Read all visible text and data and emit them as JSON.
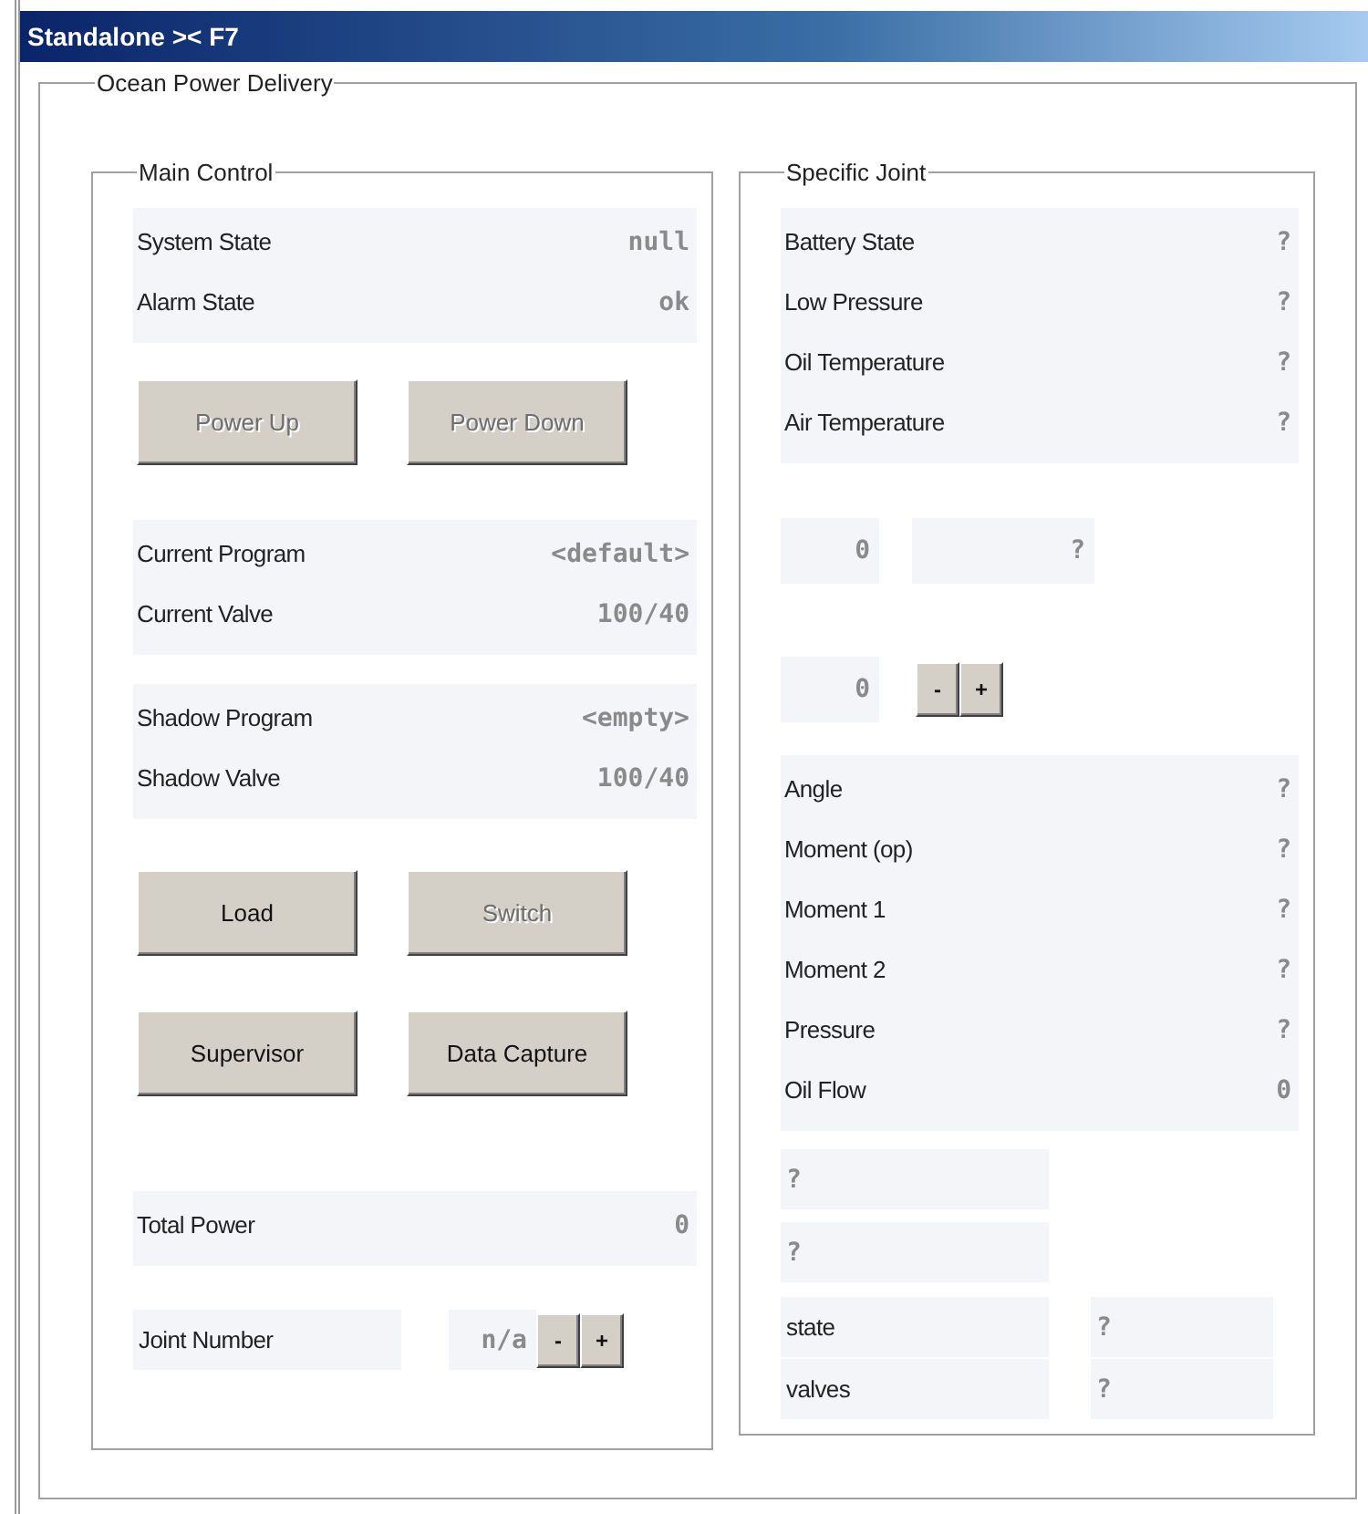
{
  "window": {
    "title": "Standalone >< F7"
  },
  "group": {
    "title": "Ocean Power Delivery"
  },
  "main_control": {
    "title": "Main Control",
    "status": [
      {
        "label": "System State",
        "value": "null"
      },
      {
        "label": "Alarm State",
        "value": "ok"
      }
    ],
    "power_buttons": [
      {
        "label": "Power Up",
        "disabled": true
      },
      {
        "label": "Power Down",
        "disabled": true
      }
    ],
    "current": [
      {
        "label": "Current Program",
        "value": "<default>"
      },
      {
        "label": "Current Valve",
        "value": "100/40"
      }
    ],
    "shadow": [
      {
        "label": "Shadow Program",
        "value": "<empty>"
      },
      {
        "label": "Shadow Valve",
        "value": "100/40"
      }
    ],
    "program_buttons": [
      {
        "label": "Load",
        "disabled": false
      },
      {
        "label": "Switch",
        "disabled": true
      }
    ],
    "tool_buttons": [
      {
        "label": "Supervisor",
        "disabled": false
      },
      {
        "label": "Data Capture",
        "disabled": false
      }
    ],
    "total_power": {
      "label": "Total Power",
      "value": "0"
    },
    "joint_number": {
      "label": "Joint Number",
      "value": "n/a",
      "steppers": [
        "-",
        "+"
      ]
    }
  },
  "specific_joint": {
    "title": "Specific Joint",
    "sensors": [
      {
        "label": "Battery State",
        "value": "?"
      },
      {
        "label": "Low Pressure",
        "value": "?"
      },
      {
        "label": "Oil Temperature",
        "value": "?"
      },
      {
        "label": "Air Temperature",
        "value": "?"
      }
    ],
    "indicator": {
      "value": "0",
      "reading": "?"
    },
    "stepper": {
      "value": "0",
      "steppers": [
        "-",
        "+"
      ]
    },
    "measurements": [
      {
        "label": "Angle",
        "value": "?"
      },
      {
        "label": "Moment (op)",
        "value": "?"
      },
      {
        "label": "Moment 1",
        "value": "?"
      },
      {
        "label": "Moment 2",
        "value": "?"
      },
      {
        "label": "Pressure",
        "value": "?"
      },
      {
        "label": "Oil Flow",
        "value": "0"
      }
    ],
    "readouts": [
      "?",
      "?"
    ],
    "fields": [
      {
        "label": "state",
        "value": "?"
      },
      {
        "label": "valves",
        "value": "?"
      }
    ]
  }
}
